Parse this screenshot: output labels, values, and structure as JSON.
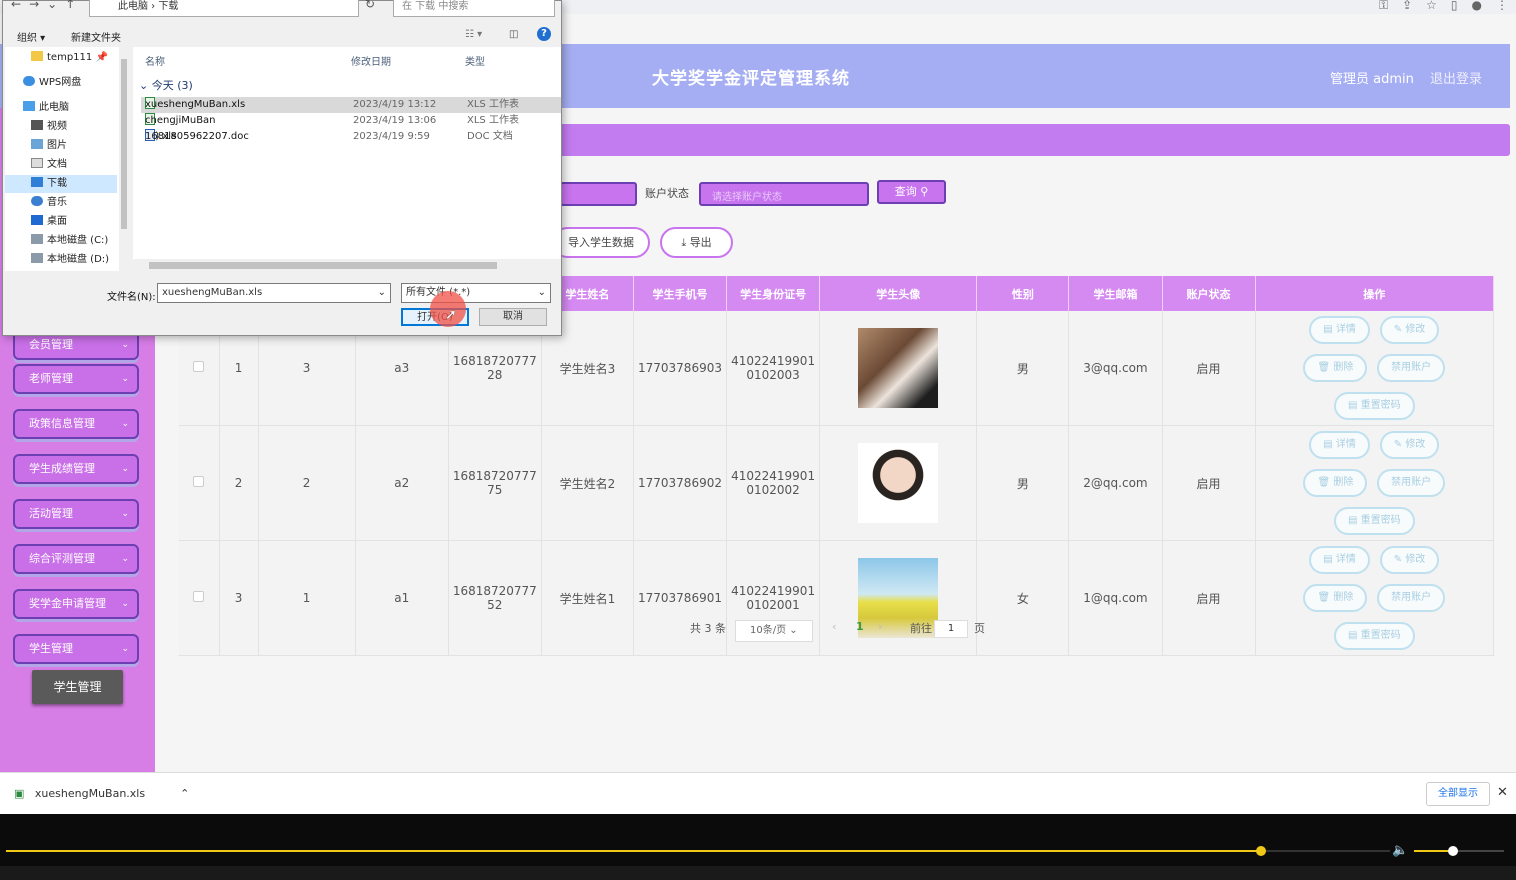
{
  "browser": {
    "icons": [
      "key-icon",
      "share-icon",
      "star-icon",
      "sidebar-icon",
      "profile-icon",
      "more-icon"
    ]
  },
  "header": {
    "title": "大学奖学金评定管理系统",
    "user": "管理员 admin",
    "logout": "退出登录"
  },
  "sidebar": {
    "partial_item": "会员管理",
    "menu": [
      "老师管理",
      "政策信息管理",
      "学生成绩管理",
      "活动管理",
      "综合评测管理",
      "奖学金申请管理",
      "学生管理"
    ],
    "active_sub": "学生管理"
  },
  "filters": {
    "account_status_label": "账户状态",
    "account_status_placeholder": "请选择账户状态",
    "search_button": "查询"
  },
  "actions": {
    "import_label": "导入学生数据",
    "export_label": "导出"
  },
  "table": {
    "headers": [
      "学生姓名",
      "学生手机号",
      "学生身份证号",
      "学生头像",
      "性别",
      "学生邮箱",
      "账户状态",
      "操作"
    ],
    "rows": [
      {
        "index": "1",
        "c2": "3",
        "c3": "a3",
        "c4_line1": "16818720777",
        "c4_line2": "28",
        "name": "学生姓名3",
        "phone": "17703786903",
        "id_line1": "41022419901",
        "id_line2": "0102003",
        "gender": "男",
        "email": "3@qq.com",
        "status": "启用"
      },
      {
        "index": "2",
        "c2": "2",
        "c3": "a2",
        "c4_line1": "16818720777",
        "c4_line2": "75",
        "name": "学生姓名2",
        "phone": "17703786902",
        "id_line1": "41022419901",
        "id_line2": "0102002",
        "gender": "男",
        "email": "2@qq.com",
        "status": "启用"
      },
      {
        "index": "3",
        "c2": "1",
        "c3": "a1",
        "c4_line1": "16818720777",
        "c4_line2": "52",
        "name": "学生姓名1",
        "phone": "17703786901",
        "id_line1": "41022419901",
        "id_line2": "0102001",
        "gender": "女",
        "email": "1@qq.com",
        "status": "启用"
      }
    ],
    "op_labels": {
      "detail": "详情",
      "edit": "修改",
      "delete": "删除",
      "disable": "禁用账户",
      "reset": "重置密码"
    }
  },
  "pagination": {
    "total": "共 3 条",
    "page_size": "10条/页",
    "current": "1",
    "goto_label": "前往",
    "goto_value": "1",
    "page_suffix": "页"
  },
  "dialog": {
    "breadcrumb": "此电脑 › 下载",
    "search_placeholder": "在 下载 中搜索",
    "organize": "组织 ▾",
    "new_folder": "新建文件夹",
    "nav_items": [
      "temp111",
      "WPS网盘",
      "此电脑",
      "视频",
      "图片",
      "文档",
      "下载",
      "音乐",
      "桌面",
      "本地磁盘 (C:)",
      "本地磁盘 (D:)"
    ],
    "columns": {
      "name": "名称",
      "modified": "修改日期",
      "type": "类型"
    },
    "group": "今天 (3)",
    "files": [
      {
        "name": "xueshengMuBan.xls",
        "date": "2023/4/19 13:12",
        "type": "XLS 工作表"
      },
      {
        "name": "chengjiMuBan (1).xls",
        "date": "2023/4/19 13:06",
        "type": "XLS 工作表"
      },
      {
        "name": "1681805962207.doc",
        "date": "2023/4/19 9:59",
        "type": "DOC 文档"
      }
    ],
    "filename_label": "文件名(N):",
    "filename_value": "xueshengMuBan.xls",
    "filetype_value": "所有文件 (*.*)",
    "open_button": "打开(O)",
    "cancel_button": "取消"
  },
  "download_bar": {
    "file": "xueshengMuBan.xls",
    "show_all": "全部显示"
  },
  "player": {
    "progress": 0.907,
    "volume": 0.43
  }
}
